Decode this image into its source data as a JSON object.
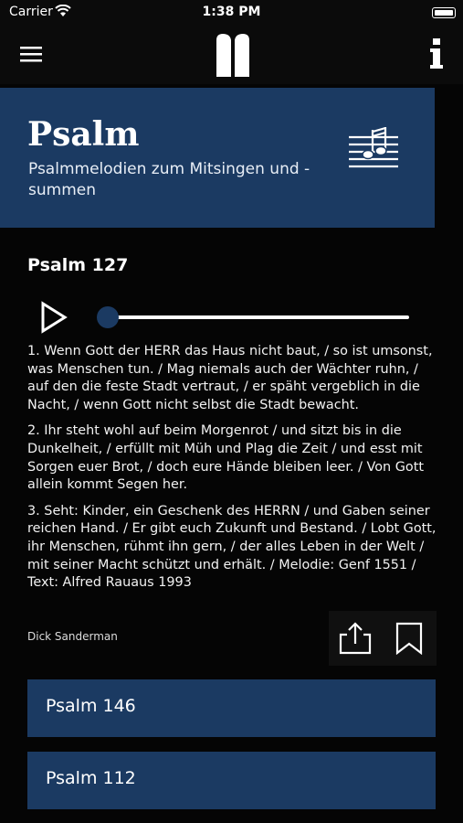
{
  "status_bar": {
    "carrier": "Carrier",
    "time": "1:38 PM"
  },
  "nav": {
    "menu_icon": "hamburger-menu-icon",
    "logo_icon": "book-logo-icon",
    "info_icon": "info-icon"
  },
  "hero": {
    "title": "Psalm",
    "subtitle": "Psalmmelodien zum Mitsingen und -summen",
    "icon": "music-notes-icon",
    "background_color": "#1b3a62"
  },
  "song": {
    "title": "Psalm 127",
    "progress": 0,
    "verses": [
      "1. Wenn Gott der HERR das Haus nicht baut,  / so ist umsonst, was Menschen tun.  / Mag niemals auch der Wächter ruhn,  / auf den die feste Stadt vertraut,  / er späht vergeblich in die Nacht,  / wenn Gott nicht selbst die Stadt bewacht.",
      "2. Ihr steht wohl auf beim Morgenrot  / und sitzt bis in die Dunkelheit,  / erfüllt mit Müh und Plag die Zeit  / und esst mit Sorgen euer Brot,  / doch eure Hände bleiben leer.  / Von Gott allein kommt Segen her.",
      "3. Seht: Kinder, ein Geschenk des HERRN  / und Gaben seiner reichen Hand.  / Er gibt euch Zukunft und Bestand.  / Lobt Gott, ihr Menschen, rühmt ihn gern,  / der alles Leben in der Welt  / mit seiner Macht schützt und erhält.  / Melodie: Genf 1551  / Text: Alfred Rauaus 1993"
    ],
    "author": "Dick Sanderman"
  },
  "actions": {
    "share_icon": "share-icon",
    "bookmark_icon": "bookmark-icon"
  },
  "related": [
    {
      "label": "Psalm 146"
    },
    {
      "label": "Psalm 112"
    }
  ]
}
